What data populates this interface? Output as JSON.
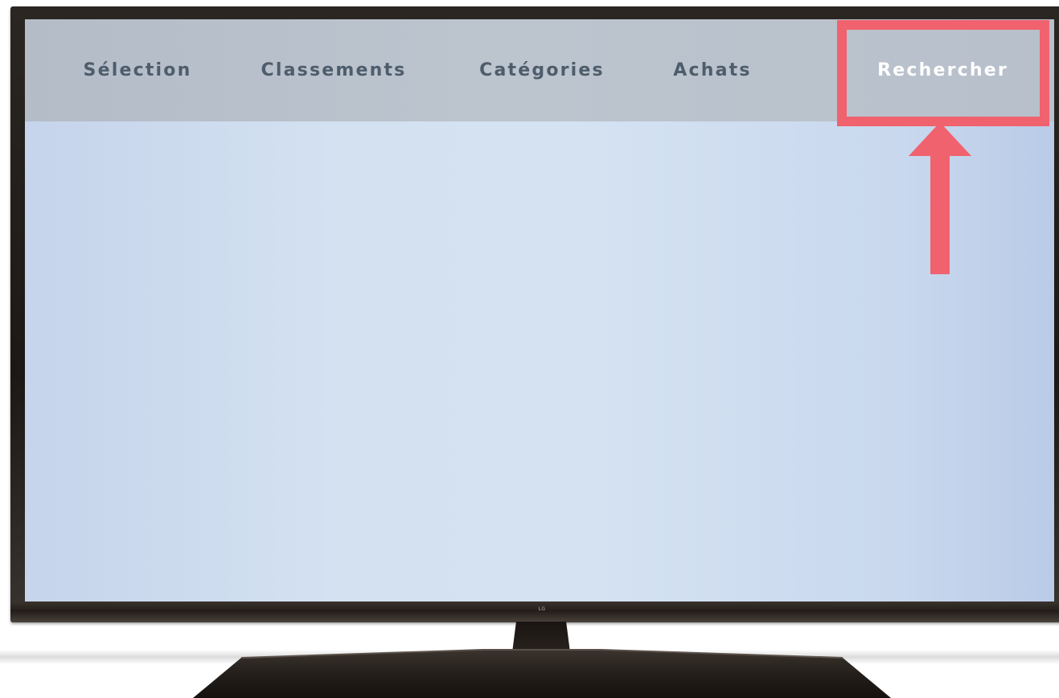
{
  "menu": {
    "items": [
      {
        "label": "Sélection"
      },
      {
        "label": "Classements"
      },
      {
        "label": "Catégories"
      },
      {
        "label": "Achats"
      },
      {
        "label": "Rechercher"
      }
    ],
    "highlighted_item": "Rechercher"
  },
  "device": {
    "brand_logo": "LG"
  },
  "colors": {
    "highlight": "#f0626e",
    "menu_text": "#4e5d6b",
    "menu_text_active": "#ffffff",
    "menu_bar": "#b8c0cb",
    "screen_background": "#d3e1f1"
  },
  "icons": {
    "annotation_arrow": "arrow-up-icon"
  }
}
